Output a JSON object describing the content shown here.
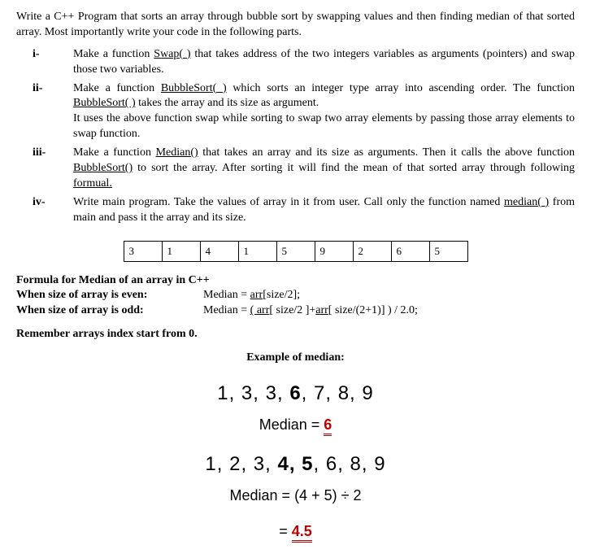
{
  "intro": "Write a C++ Program that sorts an array through bubble sort by swapping values and then finding median of that sorted array. Most importantly write your code in the following parts.",
  "parts": [
    {
      "num": "i-",
      "pre1": "Make a function ",
      "fn1": "Swap( )",
      "post1": " that takes address of the two integers variables as arguments (pointers) and swap those two variables."
    },
    {
      "num": "ii-",
      "pre1": "Make a function ",
      "fn1": "BubbleSort( )",
      "post1": " which sorts an integer type array into ascending order. The function ",
      "fn2": "BubbleSort( )",
      "post2": " takes the array and its size as argument.",
      "line2": "It uses the above function swap while sorting to swap two array elements by passing those array elements to swap function."
    },
    {
      "num": "iii-",
      "pre1": "Make a function ",
      "fn1": "Median()",
      "post1": " that takes an array and its size as arguments. Then it calls the above function ",
      "fn2": "BubbleSort()",
      "post2": " to sort the array. After sorting it will find the mean of that sorted array through following ",
      "fn3": "formual."
    },
    {
      "num": "iv-",
      "pre1": "Write main program. Take the values of array in it from user. Call only the function named ",
      "fn1": "median( )",
      "post1": " from main and pass it the array and its size."
    }
  ],
  "array_cells": [
    "3",
    "1",
    "4",
    "1",
    "5",
    "9",
    "2",
    "6",
    "5"
  ],
  "formula": {
    "title": "Formula for Median of an array in C++",
    "even_label": "When size of array is even:",
    "even_pre": "Median = ",
    "even_u": "arr",
    "even_post": "[size/2];",
    "odd_label": "When size of array is odd:",
    "odd_pre": "Median = ",
    "odd_u1": "( arr",
    "odd_mid": "[ size/2 ]+",
    "odd_u2": "arr",
    "odd_post": "[ size/(2+1)] ) / 2.0;"
  },
  "reminder": "Remember arrays index start from 0.",
  "example_title": "Example of median:",
  "ex1": {
    "seq_pre": "1, 3, 3, ",
    "seq_b": "6",
    "seq_post": ", 7, 8, 9",
    "mlabel": "Median  =  ",
    "mval": "6"
  },
  "ex2": {
    "seq_pre": "1, 2, 3, ",
    "seq_b": "4, 5",
    "seq_post": ", 6, 8, 9",
    "mlabel": "Median  =  ",
    "mexpr": "(4 + 5) ÷ 2",
    "eq": "=  ",
    "mval": "4.5"
  }
}
